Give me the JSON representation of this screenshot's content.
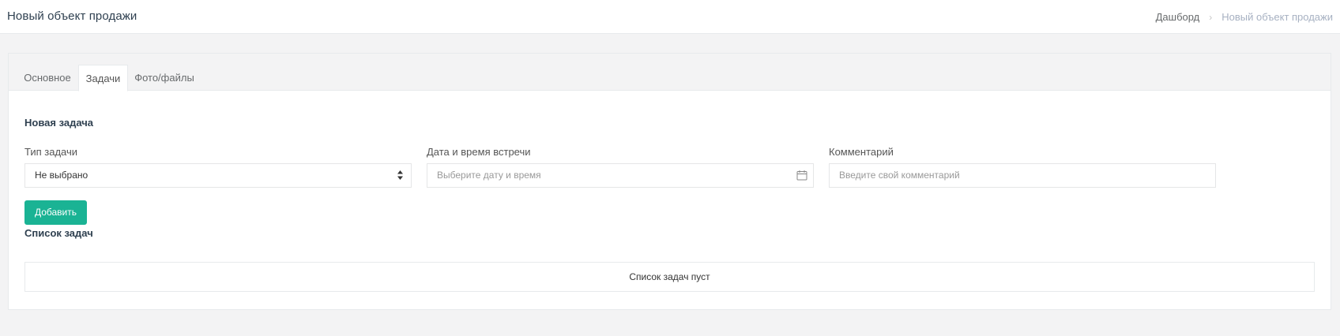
{
  "header": {
    "title": "Новый объект продажи",
    "breadcrumb": {
      "home": "Дашборд",
      "separator": "›",
      "current": "Новый объект продажи"
    }
  },
  "tabs": [
    {
      "label": "Основное",
      "active": false
    },
    {
      "label": "Задачи",
      "active": true
    },
    {
      "label": "Фото/файлы",
      "active": false
    }
  ],
  "new_task": {
    "title": "Новая задача",
    "type_label": "Тип задачи",
    "type_value": "Не выбрано",
    "datetime_label": "Дата и время встречи",
    "datetime_placeholder": "Выберите дату и время",
    "comment_label": "Комментарий",
    "comment_placeholder": "Введите свой комментарий",
    "add_button": "Добавить"
  },
  "task_list": {
    "title": "Список задач",
    "empty_text": "Список задач пуст"
  },
  "colors": {
    "accent": "#1ab394",
    "background": "#f3f3f4",
    "title": "#2f4050"
  },
  "icons": {
    "select_arrows": "sort-arrows-icon",
    "calendar": "calendar-icon"
  }
}
